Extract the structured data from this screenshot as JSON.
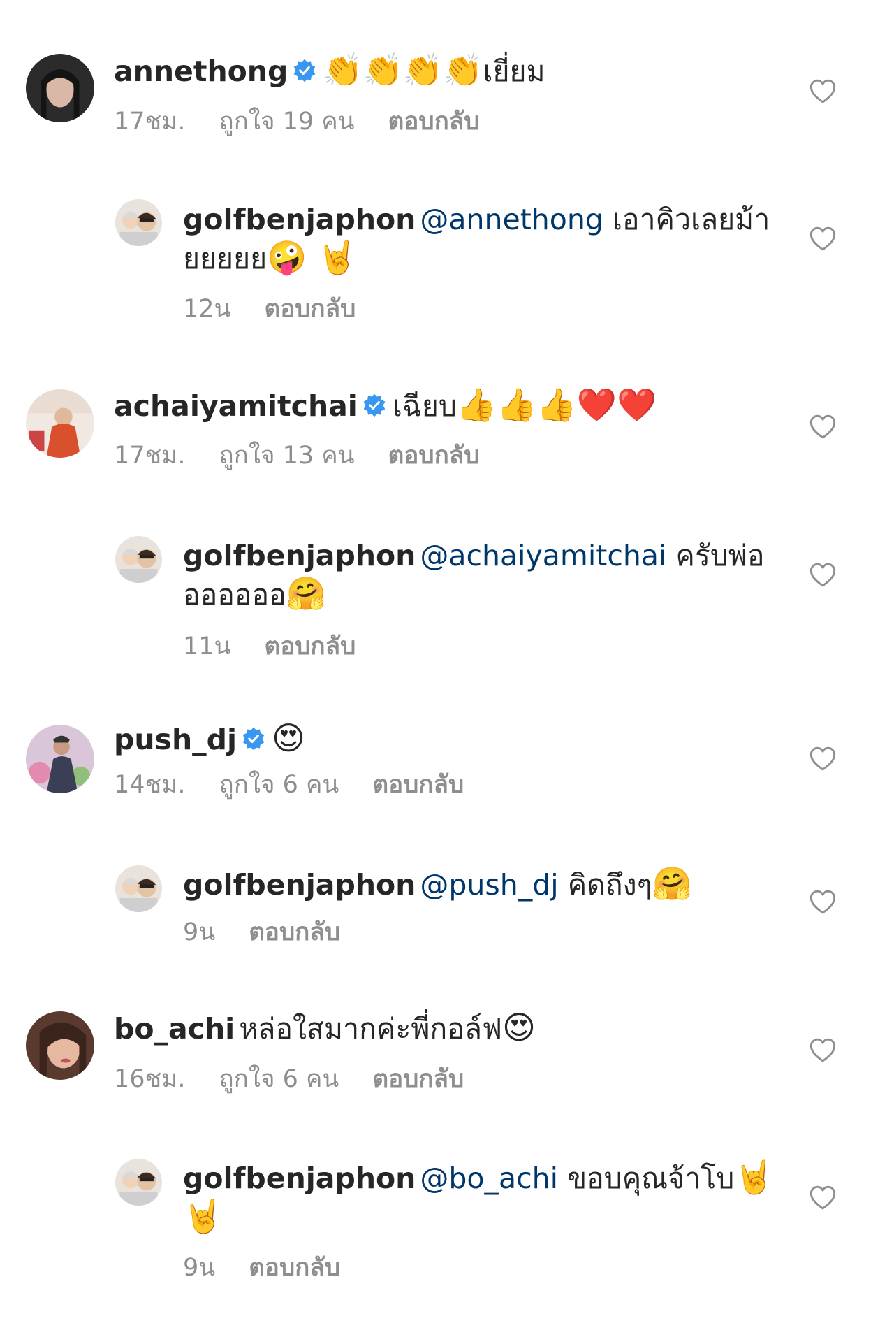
{
  "comments": [
    {
      "username": "annethong",
      "verified": true,
      "text": "",
      "emoji": "👏👏👏👏",
      "text_after": "เยี่ยม",
      "time": "17ชม.",
      "likes": "ถูกใจ 19 คน",
      "reply_label": "ตอบกลับ"
    },
    {
      "username": "golfbenjaphon",
      "mention": "@annethong",
      "text": " เอาคิวเลยม้ายยยยย",
      "emoji": "🤪 🤘",
      "time": "12น",
      "reply_label": "ตอบกลับ"
    },
    {
      "username": "achaiyamitchai",
      "verified": true,
      "text": "เฉียบ",
      "emoji": "👍👍👍❤️❤️",
      "time": "17ชม.",
      "likes": "ถูกใจ 13 คน",
      "reply_label": "ตอบกลับ"
    },
    {
      "username": "golfbenjaphon",
      "mention": "@achaiyamitchai",
      "text": " ครับพ่อออออออ",
      "emoji": "🤗",
      "time": "11น",
      "reply_label": "ตอบกลับ"
    },
    {
      "username": "push_dj",
      "verified": true,
      "text": "",
      "emoji": "😍",
      "time": "14ชม.",
      "likes": "ถูกใจ 6 คน",
      "reply_label": "ตอบกลับ"
    },
    {
      "username": "golfbenjaphon",
      "mention": "@push_dj",
      "text": " คิดถึงๆ",
      "emoji": "🤗",
      "time": "9น",
      "reply_label": "ตอบกลับ"
    },
    {
      "username": "bo_achi",
      "text": "หล่อใสมากค่ะพี่กอล์ฟ",
      "emoji": "😍",
      "time": "16ชม.",
      "likes": "ถูกใจ 6 คน",
      "reply_label": "ตอบกลับ"
    },
    {
      "username": "golfbenjaphon",
      "mention": "@bo_achi",
      "text": " ขอบคุณจ้าโบ",
      "emoji": "🤘 🤘",
      "time": "9น",
      "reply_label": "ตอบกลับ"
    }
  ],
  "icons": {
    "like": "heart-outline-icon",
    "verified": "verified-badge-icon"
  },
  "colors": {
    "text": "#262626",
    "meta": "#8e8e8e",
    "mention": "#00376b",
    "verified": "#3897f0"
  }
}
